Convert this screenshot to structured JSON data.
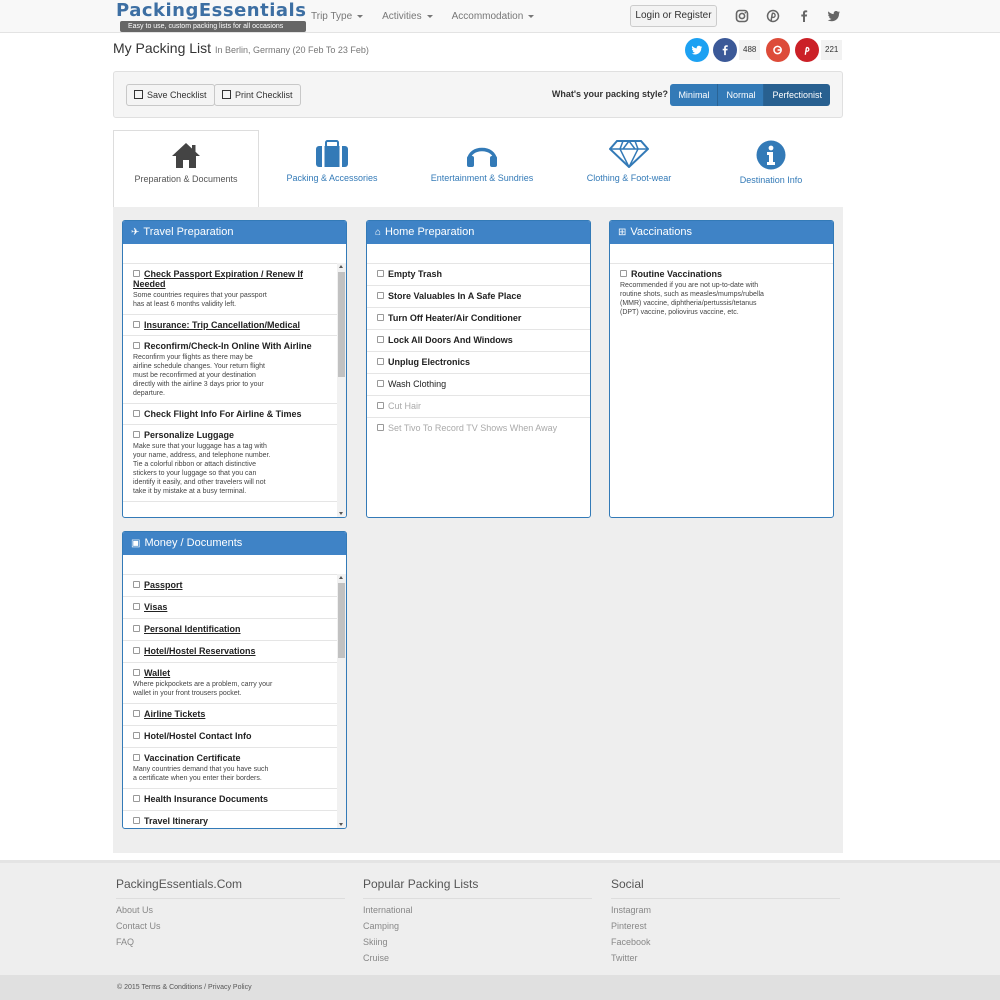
{
  "brand": {
    "name": "PackingEssentials",
    "tagline": "Easy to use, custom packing lists for all occasions"
  },
  "nav": {
    "items": [
      "Trip Type",
      "Activities",
      "Accommodation"
    ],
    "login": "Login or Register",
    "social_icons": [
      "instagram-icon",
      "pinterest-icon",
      "facebook-icon",
      "twitter-icon"
    ]
  },
  "page": {
    "title": "My Packing List",
    "subtitle": "In Berlin, Germany (20 Feb To 23 Feb)"
  },
  "share": {
    "facebook_count": "488",
    "pinterest_count": "221"
  },
  "toolbar": {
    "save": "Save Checklist",
    "print": "Print Checklist",
    "style_label": "What's your packing style?",
    "styles": [
      "Minimal",
      "Normal",
      "Perfectionist"
    ],
    "selected_style": "Perfectionist"
  },
  "tabs": [
    {
      "label": "Preparation & Documents",
      "icon": "house-icon"
    },
    {
      "label": "Packing & Accessories",
      "icon": "suitcase-icon"
    },
    {
      "label": "Entertainment & Sundries",
      "icon": "headphones-icon"
    },
    {
      "label": "Clothing & Foot-wear",
      "icon": "diamond-icon"
    },
    {
      "label": "Destination Info",
      "icon": "info-icon"
    }
  ],
  "panels": {
    "travel": {
      "title": "Travel Preparation",
      "items": [
        {
          "title": "Check Passport Expiration / Renew If Needed",
          "desc": "Some countries requires that your passport\nhas at least 6 months validity left."
        },
        {
          "title": "Insurance: Trip Cancellation/Medical",
          "desc": ""
        },
        {
          "title": "Reconfirm/Check-In Online With Airline",
          "desc": "Reconfirm your flights as there may be\nairline schedule changes. Your return flight\nmust be reconfirmed at your destination\ndirectly with the airline 3 days prior to your\ndeparture."
        },
        {
          "title": "Check Flight Info For Airline & Times",
          "desc": ""
        },
        {
          "title": "Personalize Luggage",
          "desc": "Make sure that your luggage has a tag with\nyour name, address, and telephone number.\nTie a colorful ribbon or attach distinctive\nstickers to your luggage so that you can\nidentify it easily, and other travelers will not\ntake it by mistake at a busy terminal."
        }
      ]
    },
    "home": {
      "title": "Home Preparation",
      "items": [
        "Empty Trash",
        "Store Valuables In A Safe Place",
        "Turn Off Heater/Air Conditioner",
        "Lock All Doors And Windows",
        "Unplug Electronics",
        "Wash Clothing",
        "Cut Hair",
        "Set Tivo To Record TV Shows When Away"
      ]
    },
    "vaccinations": {
      "title": "Vaccinations",
      "items": [
        {
          "title": "Routine Vaccinations",
          "desc": "Recommended if you are not up-to-date with\nroutine shots, such as measles/mumps/rubella\n(MMR) vaccine, diphtheria/pertussis/tetanus\n(DPT) vaccine, poliovirus vaccine, etc."
        }
      ]
    },
    "money": {
      "title": "Money / Documents",
      "items": [
        {
          "title": "Passport",
          "desc": ""
        },
        {
          "title": "Visas",
          "desc": ""
        },
        {
          "title": "Personal Identification",
          "desc": ""
        },
        {
          "title": "Hotel/Hostel Reservations",
          "desc": ""
        },
        {
          "title": "Wallet",
          "desc": "Where pickpockets are a problem, carry your\nwallet in your front trousers pocket."
        },
        {
          "title": "Airline Tickets",
          "desc": ""
        },
        {
          "title": "Hotel/Hostel Contact Info",
          "desc": ""
        },
        {
          "title": "Vaccination Certificate",
          "desc": "Many countries demand that you have such\na certificate when you enter their borders."
        },
        {
          "title": "Health Insurance Documents",
          "desc": ""
        },
        {
          "title": "Travel Itinerary",
          "desc": ""
        }
      ]
    }
  },
  "footer": {
    "col1": {
      "title": "PackingEssentials.Com",
      "links": [
        "About Us",
        "Contact Us",
        "FAQ"
      ]
    },
    "col2": {
      "title": "Popular Packing Lists",
      "links": [
        "International",
        "Camping",
        "Skiing",
        "Cruise"
      ]
    },
    "col3": {
      "title": "Social",
      "links": [
        "Instagram",
        "Pinterest",
        "Facebook",
        "Twitter"
      ]
    },
    "copyright": "© 2015 Terms & Conditions / Privacy Policy"
  },
  "colors": {
    "brand_blue": "#337ab7",
    "panel_header": "#3f83c6",
    "facebook": "#3b5998",
    "twitter": "#1da1f2",
    "google": "#dd4b39",
    "pinterest": "#cb2027"
  }
}
